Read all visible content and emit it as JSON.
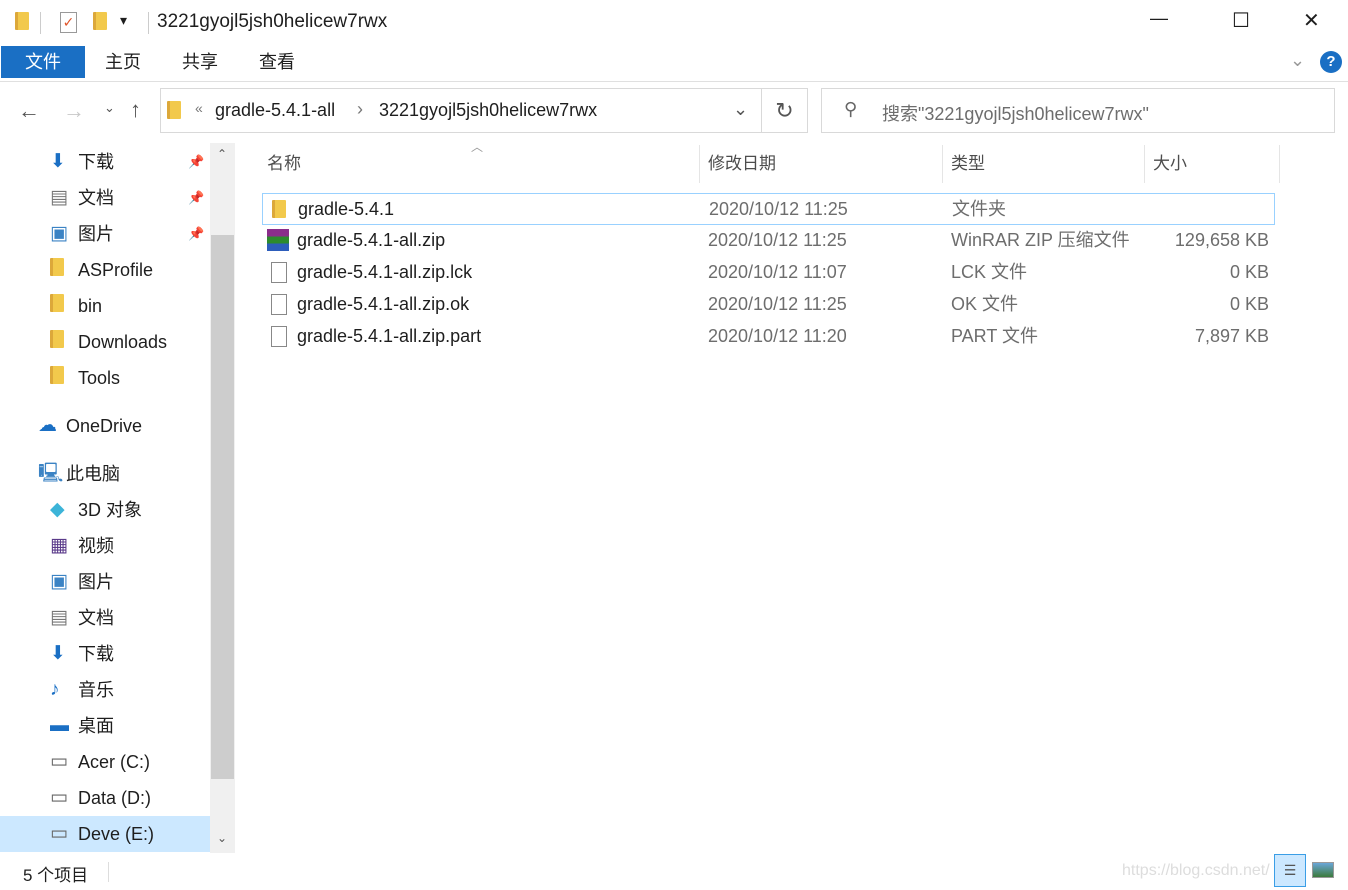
{
  "window": {
    "title": "3221gyojl5jsh0helicew7rwx",
    "minimize": "—",
    "maximize": "☐",
    "close": "✕"
  },
  "ribbon": {
    "tabs": [
      "文件",
      "主页",
      "共享",
      "查看"
    ],
    "help": "?"
  },
  "address": {
    "crumbs": [
      "gradle-5.4.1-all",
      "3221gyojl5jsh0helicew7rwx"
    ],
    "overflow": "«",
    "separator": "›"
  },
  "search": {
    "placeholder": "搜索\"3221gyojl5jsh0helicew7rwx\""
  },
  "sidebar": {
    "quick": [
      {
        "label": "下载",
        "icon": "download-icon",
        "pinned": true
      },
      {
        "label": "文档",
        "icon": "document-icon",
        "pinned": true
      },
      {
        "label": "图片",
        "icon": "pictures-icon",
        "pinned": true
      },
      {
        "label": "ASProfile",
        "icon": "folder-icon"
      },
      {
        "label": "bin",
        "icon": "folder-icon"
      },
      {
        "label": "Downloads",
        "icon": "folder-icon"
      },
      {
        "label": "Tools",
        "icon": "folder-icon"
      }
    ],
    "onedrive": "OneDrive",
    "thispc": "此电脑",
    "pc_items": [
      {
        "label": "3D 对象",
        "icon": "3d-objects-icon"
      },
      {
        "label": "视频",
        "icon": "video-icon"
      },
      {
        "label": "图片",
        "icon": "pictures-icon"
      },
      {
        "label": "文档",
        "icon": "document-icon"
      },
      {
        "label": "下载",
        "icon": "download-icon"
      },
      {
        "label": "音乐",
        "icon": "music-icon"
      },
      {
        "label": "桌面",
        "icon": "desktop-icon"
      },
      {
        "label": "Acer (C:)",
        "icon": "drive-icon"
      },
      {
        "label": "Data (D:)",
        "icon": "drive-icon"
      },
      {
        "label": "Deve (E:)",
        "icon": "drive-icon",
        "selected": true
      }
    ]
  },
  "columns": [
    "名称",
    "修改日期",
    "类型",
    "大小"
  ],
  "files": [
    {
      "name": "gradle-5.4.1",
      "date": "2020/10/12 11:25",
      "type": "文件夹",
      "size": "",
      "icon": "folder-icon"
    },
    {
      "name": "gradle-5.4.1-all.zip",
      "date": "2020/10/12 11:25",
      "type": "WinRAR ZIP 压缩文件",
      "size": "129,658 KB",
      "icon": "winrar-icon"
    },
    {
      "name": "gradle-5.4.1-all.zip.lck",
      "date": "2020/10/12 11:07",
      "type": "LCK 文件",
      "size": "0 KB",
      "icon": "file-icon"
    },
    {
      "name": "gradle-5.4.1-all.zip.ok",
      "date": "2020/10/12 11:25",
      "type": "OK 文件",
      "size": "0 KB",
      "icon": "file-icon"
    },
    {
      "name": "gradle-5.4.1-all.zip.part",
      "date": "2020/10/12 11:20",
      "type": "PART 文件",
      "size": "7,897 KB",
      "icon": "file-icon"
    }
  ],
  "status": {
    "count": "5 个项目",
    "watermark": "https://blog.csdn.net/"
  },
  "colors": {
    "accent": "#1a6fc4",
    "selection": "#cce8ff"
  }
}
